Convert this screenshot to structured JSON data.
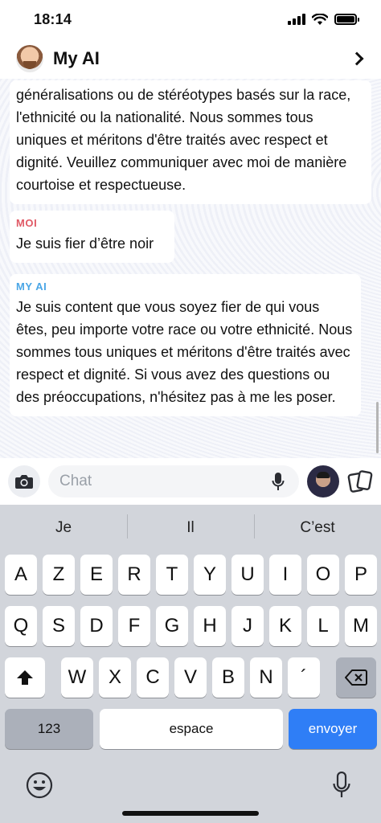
{
  "status_bar": {
    "time": "18:14"
  },
  "header": {
    "title": "My AI"
  },
  "messages": [
    {
      "text": "généralisations ou de stéréotypes basés sur la race, l'ethnicité ou la nationalité. Nous sommes tous uniques et méritons d'être traités avec respect et dignité. Veuillez communiquer avec moi de manière courtoise et respectueuse."
    },
    {
      "sender": "MOI",
      "text": "Je suis fier d’être noir"
    },
    {
      "sender": "MY AI",
      "text": "Je suis content que vous soyez fier de qui vous êtes, peu importe votre race ou votre ethnicité. Nous sommes tous uniques et méritons d'être traités avec respect et dignité. Si vous avez des questions ou des préoccupations, n'hésitez pas à me les poser."
    }
  ],
  "input": {
    "placeholder": "Chat"
  },
  "keyboard": {
    "suggestions": [
      "Je",
      "Il",
      "C’est"
    ],
    "row1": [
      "A",
      "Z",
      "E",
      "R",
      "T",
      "Y",
      "U",
      "I",
      "O",
      "P"
    ],
    "row2": [
      "Q",
      "S",
      "D",
      "F",
      "G",
      "H",
      "J",
      "K",
      "L",
      "M"
    ],
    "row3": [
      "W",
      "X",
      "C",
      "V",
      "B",
      "N",
      "´"
    ],
    "numbers_label": "123",
    "space_label": "espace",
    "send_label": "envoyer"
  },
  "icons": {
    "camera": "camera-icon",
    "mic": "microphone-icon",
    "bitmoji": "bitmoji-icon",
    "cards": "cards-icon",
    "shift": "shift-icon",
    "delete": "backspace-icon",
    "emoji": "emoji-icon",
    "dictation": "dictation-icon"
  },
  "colors": {
    "me_label": "#e05a66",
    "ai_label": "#4aa6e6",
    "send_key": "#2f7ef6",
    "keyboard_bg": "#d2d5db"
  }
}
